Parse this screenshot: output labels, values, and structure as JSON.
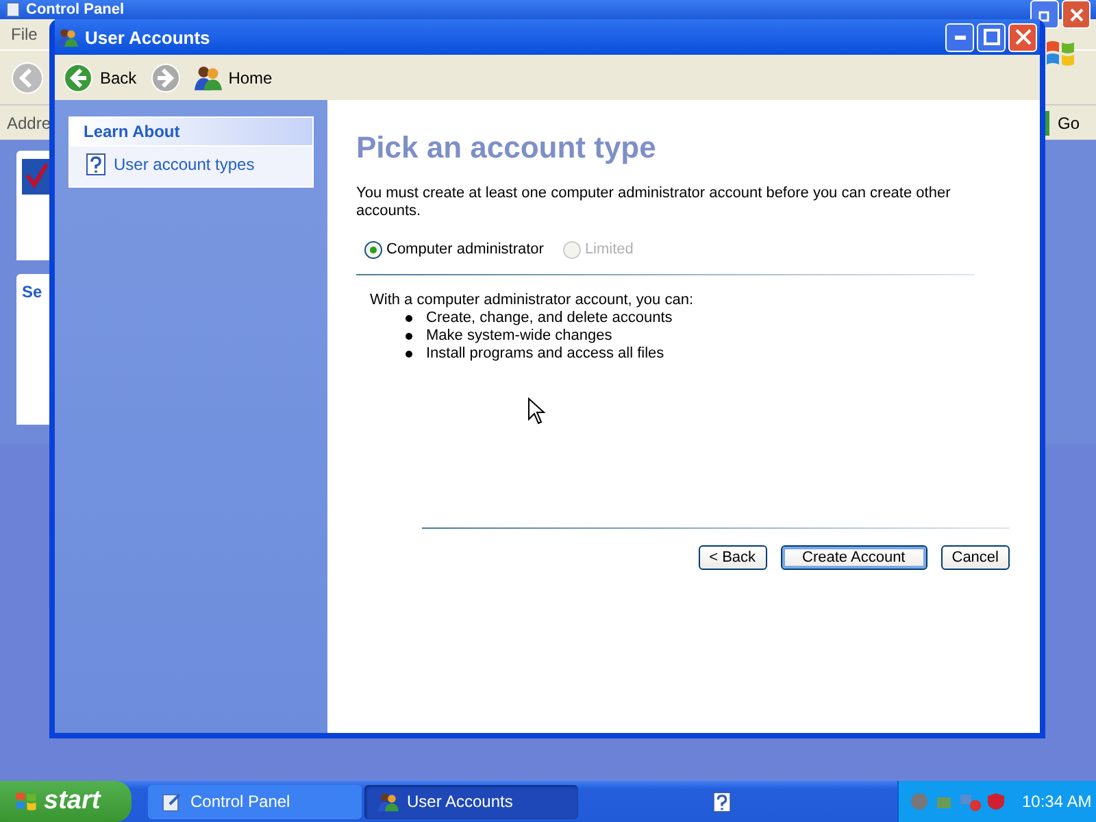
{
  "background_window": {
    "title": "Control Panel",
    "menu": [
      "File"
    ],
    "address_label": "Addre",
    "go_button": "Go",
    "panel_heading": "Se"
  },
  "window": {
    "title": "User Accounts"
  },
  "toolbar": [
    {
      "kind": "back",
      "label": "Back",
      "disabled": false
    },
    {
      "kind": "forward",
      "disabled": true
    },
    {
      "kind": "home",
      "label": "Home",
      "disabled": false
    }
  ],
  "sidebar": {
    "heading": "Learn About",
    "items": [
      {
        "label": "User account types"
      }
    ]
  },
  "page": {
    "title": "Pick an account type",
    "intro": "You must create at least one computer administrator account before you can create other accounts.",
    "options": [
      {
        "label": "Computer administrator",
        "selected": true,
        "disabled": false
      },
      {
        "label": "Limited",
        "selected": false,
        "disabled": true
      }
    ],
    "info_lead": "With a computer administrator account, you can:",
    "bullets": [
      "Create, change, and delete accounts",
      "Make system-wide changes",
      "Install programs and access all files"
    ]
  },
  "buttons": [
    {
      "label": "< Back",
      "default": false
    },
    {
      "label": "Create Account",
      "default": true
    },
    {
      "label": "Cancel",
      "default": false
    }
  ],
  "taskbar": {
    "start": "start",
    "tasks": [
      {
        "label": "Control Panel",
        "kind": "control-panel",
        "selected": false
      },
      {
        "label": "User Accounts",
        "kind": "users",
        "selected": true
      }
    ],
    "clock": "10:34 AM"
  }
}
